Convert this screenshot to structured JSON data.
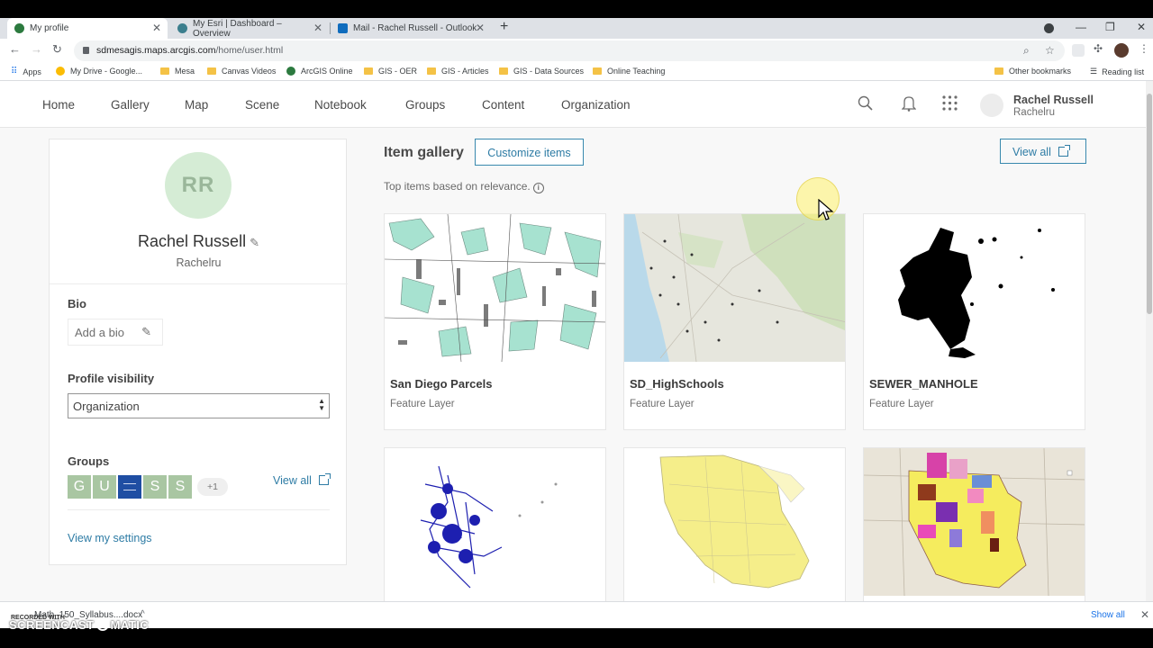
{
  "browser": {
    "tabs": [
      {
        "title": "My profile",
        "color": "#2c7a3f"
      },
      {
        "title": "My Esri | Dashboard – Overview",
        "color": "#3c7f8e"
      },
      {
        "title": "Mail - Rachel Russell - Outlook",
        "color": "#0f6cbd"
      }
    ],
    "new_tab": "+",
    "url_host": "sdmesagis.maps.arcgis.com",
    "url_path": "/home/user.html",
    "bookmarks": [
      "Apps",
      "My Drive - Google...",
      "Mesa",
      "Canvas Videos",
      "ArcGIS Online",
      "GIS - OER",
      "GIS - Articles",
      "GIS - Data Sources",
      "Online Teaching"
    ],
    "other_bookmarks": "Other bookmarks",
    "reading_list": "Reading list"
  },
  "nav": {
    "links": [
      "Home",
      "Gallery",
      "Map",
      "Scene",
      "Notebook",
      "Groups",
      "Content",
      "Organization"
    ],
    "user_name": "Rachel Russell",
    "user_handle": "Rachelru"
  },
  "profile": {
    "initials": "RR",
    "name": "Rachel Russell",
    "handle": "Rachelru",
    "bio_label": "Bio",
    "add_bio": "Add a bio",
    "visibility_label": "Profile visibility",
    "visibility_value": "Organization",
    "groups_label": "Groups",
    "groups": [
      {
        "letter": "G",
        "color": "#a9c6a2"
      },
      {
        "letter": "U",
        "color": "#a9c6a2"
      },
      {
        "letter": "",
        "color": "#1f4ea3"
      },
      {
        "letter": "S",
        "color": "#a9c6a2"
      },
      {
        "letter": "S",
        "color": "#a9c6a2"
      }
    ],
    "groups_more": "+1",
    "groups_view_all": "View all",
    "settings_link": "View my settings"
  },
  "gallery": {
    "title": "Item gallery",
    "customize": "Customize items",
    "view_all": "View all",
    "subtitle": "Top items based on relevance.",
    "items": [
      {
        "title": "San Diego Parcels",
        "type": "Feature Layer"
      },
      {
        "title": "SD_HighSchools",
        "type": "Feature Layer"
      },
      {
        "title": "SEWER_MANHOLE",
        "type": "Feature Layer"
      },
      {
        "title": "",
        "type": ""
      },
      {
        "title": "",
        "type": ""
      },
      {
        "title": "",
        "type": ""
      }
    ]
  },
  "downloads": {
    "file": "Math_150_Syllabus....docx",
    "show_all": "Show all",
    "recorded": "RECORDED WITH"
  },
  "watermark": {
    "left": "SCREENCAST",
    "right": "MATIC"
  }
}
